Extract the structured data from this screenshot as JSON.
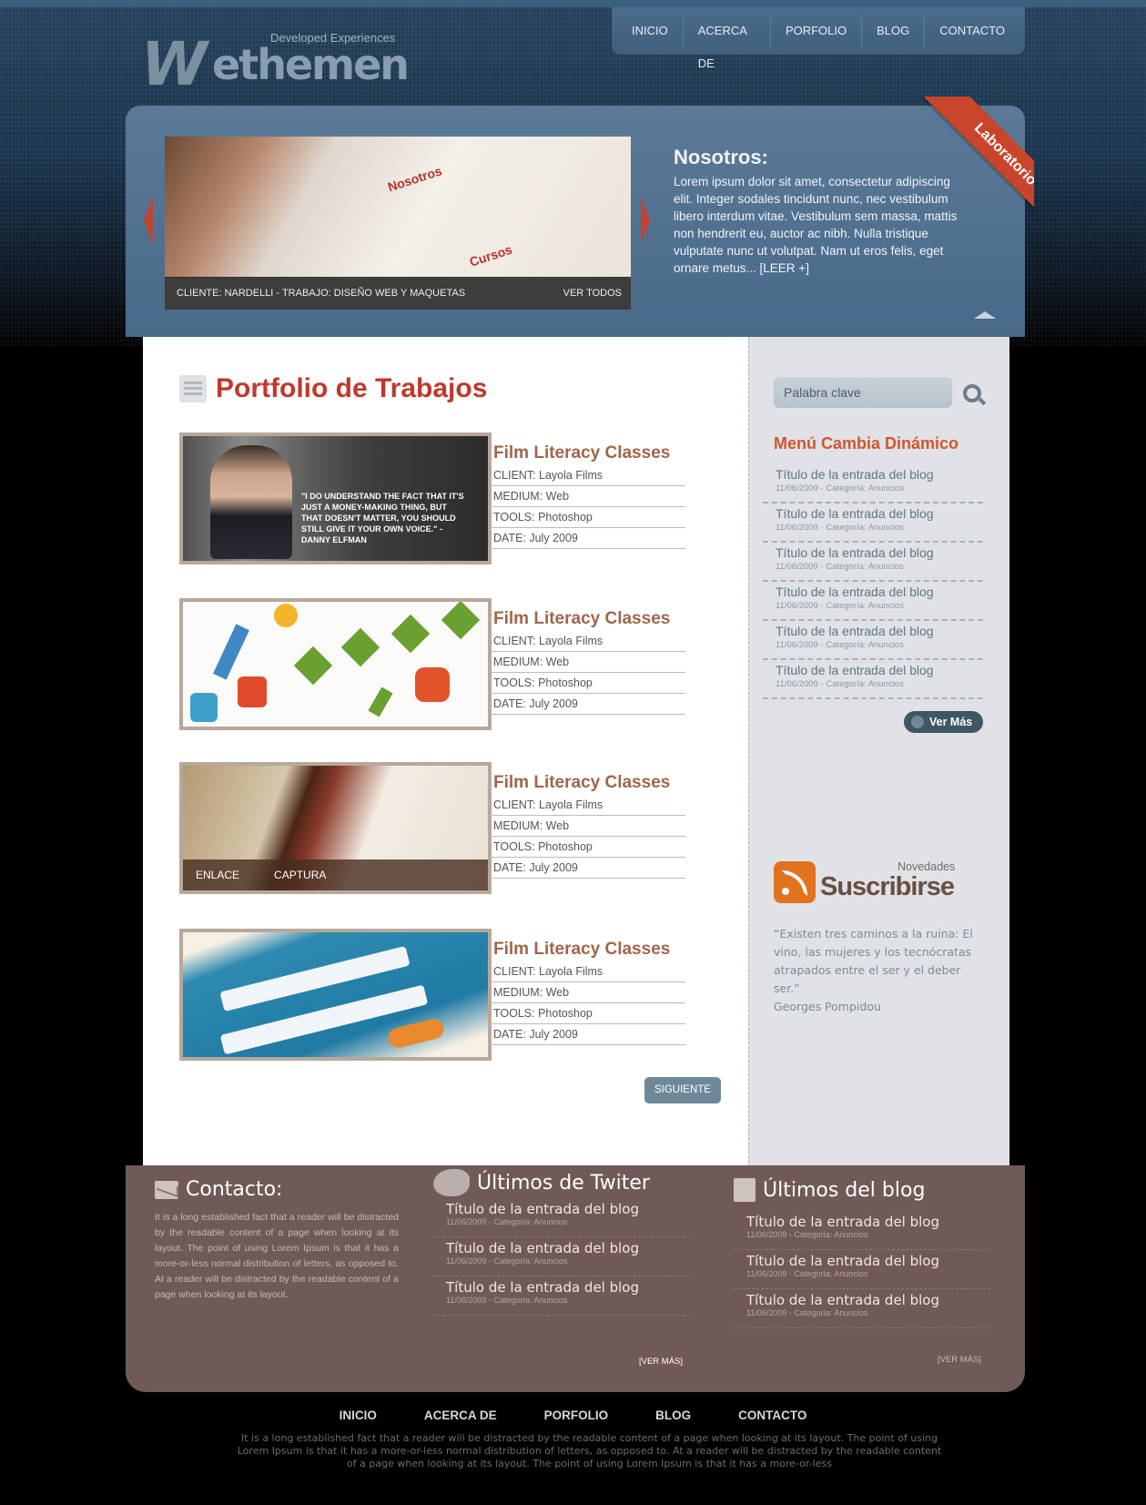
{
  "header": {
    "logo_main": "W",
    "logo_rest": "ethemen",
    "tagline": "Developed Experiences"
  },
  "nav": [
    "INICIO",
    "ACERCA DE",
    "PORFOLIO",
    "BLOG",
    "CONTACTO"
  ],
  "slider": {
    "caption": "CLIENTE: NARDELLI - TRABAJO: DISEÑO WEB Y MAQUETAS",
    "view_all": "VER TODOS",
    "slide_doc_title": "Nosotros",
    "slide_doc_section": "Cursos",
    "ribbon": "Laboratorio",
    "about_title": "Nosotros:",
    "about_text": "Lorem ipsum dolor sit amet, consectetur adipiscing elit. Integer sodales tincidunt nunc, nec vestibulum libero interdum vitae. Vestibulum sem massa, mattis non hendrerit eu, auctor ac nibh. Nulla tristique vulputate nunc ut volutpat. Nam ut eros felis, eget ornare metus... [LEER +]"
  },
  "portfolio": {
    "title": "Portfolio de Trabajos",
    "items": [
      {
        "title": "Film Literacy Classes",
        "client": "CLIENT: Layola Films",
        "medium": "MEDIUM: Web",
        "tools": "TOOLS: Photoshop",
        "date": "DATE: July 2009",
        "quote": "\"I DO UNDERSTAND THE FACT THAT IT'S JUST A MONEY-MAKING THING, BUT THAT DOESN'T MATTER, YOU SHOULD STILL GIVE IT YOUR OWN VOICE.\" - DANNY ELFMAN"
      },
      {
        "title": "Film Literacy Classes",
        "client": "CLIENT: Layola Films",
        "medium": "MEDIUM: Web",
        "tools": "TOOLS: Photoshop",
        "date": "DATE: July 2009"
      },
      {
        "title": "Film Literacy Classes",
        "client": "CLIENT: Layola Films",
        "medium": "MEDIUM: Web",
        "tools": "TOOLS: Photoshop",
        "date": "DATE: July 2009",
        "link_label": "ENLACE",
        "capture_label": "CAPTURA"
      },
      {
        "title": "Film Literacy Classes",
        "client": "CLIENT: Layola Films",
        "medium": "MEDIUM: Web",
        "tools": "TOOLS: Photoshop",
        "date": "DATE: July 2009"
      }
    ],
    "next_label": "SIGUIENTE"
  },
  "sidebar": {
    "search_placeholder": "Palabra clave",
    "menu_title": "Menú Cambia Dinámico",
    "menu_items": [
      {
        "title": "Título de la entrada del blog",
        "meta": "11/06/2009 - Categoría: Anuncios"
      },
      {
        "title": "Título de la entrada del blog",
        "meta": "11/06/2009 - Categoría: Anuncios"
      },
      {
        "title": "Título de la entrada del blog",
        "meta": "11/06/2009 - Categoría: Anuncios"
      },
      {
        "title": "Título de la entrada del blog",
        "meta": "11/06/2009 - Categoría: Anuncios"
      },
      {
        "title": "Título de la entrada del blog",
        "meta": "11/06/2009 - Categoría: Anuncios"
      },
      {
        "title": "Título de la entrada del blog",
        "meta": "11/06/2009 - Categoría: Anuncios"
      }
    ],
    "more_label": "Ver Más",
    "news_label": "Novedades",
    "subscribe_label": "Suscribirse",
    "quote": "“Existen tres caminos a la ruina: El vino, las mujeres y los tecnócratas atrapados entre el ser y el deber ser.”",
    "quote_author": "Georges Pompidou"
  },
  "footer": {
    "contact_title": "Contacto:",
    "contact_text": "It is a long established fact that a reader will be distracted by the readable content of a page when looking at its layout. The point of using Lorem Ipsum is that it has a more-or-less normal distribution of letters, as opposed to. At a reader will be distracted by the readable content of a page when looking at its layout.",
    "twitter_title": "Últimos de Twiter",
    "twitter_items": [
      {
        "title": "Título de la entrada del blog",
        "meta": "11/06/2009 - Categoría: Anuncios"
      },
      {
        "title": "Título de la entrada del blog",
        "meta": "11/06/2009 - Categoría: Anuncios"
      },
      {
        "title": "Título de la entrada del blog",
        "meta": "11/06/2009 - Categoría: Anuncios"
      }
    ],
    "twitter_more": "[VER MÁS]",
    "blog_title": "Últimos del blog",
    "blog_items": [
      {
        "title": "Título de la entrada del blog",
        "meta": "11/06/2009 - Categoría: Anuncios"
      },
      {
        "title": "Título de la entrada del blog",
        "meta": "11/06/2009 - Categoría: Anuncios"
      },
      {
        "title": "Título de la entrada del blog",
        "meta": "11/06/2009 - Categoría: Anuncios"
      }
    ],
    "blog_more": "[VER MÁS]"
  },
  "bottom_nav": [
    "INICIO",
    "ACERCA DE",
    "PORFOLIO",
    "BLOG",
    "CONTACTO"
  ],
  "bottom_text": "It is a long established fact that a reader will be distracted by the readable content of a page when looking at its layout. The point of using Lorem Ipsum is that it has a more-or-less normal distribution of letters, as opposed to. At a reader will be distracted by the readable content of a page when looking at its layout. The point of using Lorem Ipsum is that it has a more-or-less",
  "colors": {
    "accent": "#c0392b",
    "brand": "#49698a",
    "footer": "#6f5a58",
    "sidebar": "#e0e2e5"
  }
}
